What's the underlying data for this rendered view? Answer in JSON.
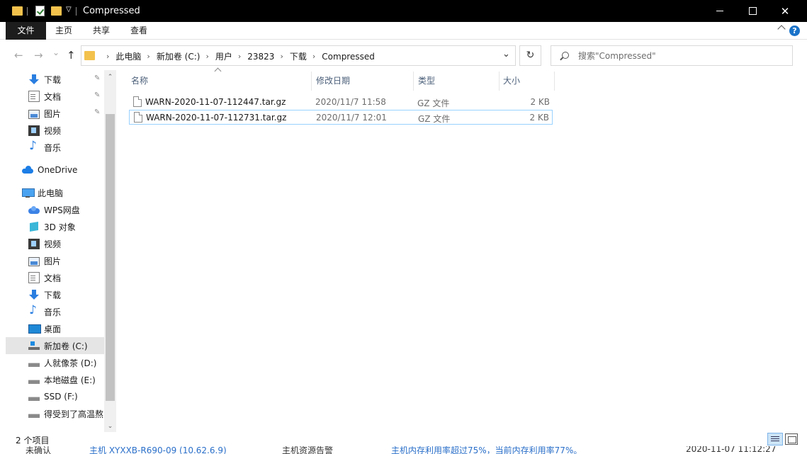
{
  "window": {
    "title": "Compressed",
    "minimize_glyph": "",
    "maximize_glyph": "",
    "close_glyph": "✕"
  },
  "ribbon": {
    "tabs": [
      "文件",
      "主页",
      "共享",
      "查看"
    ],
    "help_glyph": "?"
  },
  "nav": {
    "back_glyph": "←",
    "forward_glyph": "→",
    "recent_glyph": "⌄",
    "up_glyph": "↑",
    "breadcrumb": [
      "此电脑",
      "新加卷 (C:)",
      "用户",
      "23823",
      "下载",
      "Compressed"
    ],
    "crumb_sep": "›",
    "address_dropdown_glyph": "⌄",
    "refresh_glyph": "↻",
    "search_placeholder": "搜索\"Compressed\""
  },
  "sidebar": {
    "items": [
      {
        "label": "下载",
        "icon": "download-icon",
        "pinned": true
      },
      {
        "label": "文档",
        "icon": "document-icon",
        "pinned": true
      },
      {
        "label": "图片",
        "icon": "picture-icon",
        "pinned": true
      },
      {
        "label": "视频",
        "icon": "video-icon",
        "pinned": false
      },
      {
        "label": "音乐",
        "icon": "music-icon",
        "pinned": false
      },
      {
        "label": "OneDrive",
        "icon": "onedrive-icon",
        "pinned": false
      },
      {
        "label": "此电脑",
        "icon": "this-pc-icon",
        "pinned": false
      },
      {
        "label": "WPS网盘",
        "icon": "wps-cloud-icon",
        "pinned": false
      },
      {
        "label": "3D 对象",
        "icon": "3d-objects-icon",
        "pinned": false
      },
      {
        "label": "视频",
        "icon": "video-icon",
        "pinned": false
      },
      {
        "label": "图片",
        "icon": "picture-icon",
        "pinned": false
      },
      {
        "label": "文档",
        "icon": "document-icon",
        "pinned": false
      },
      {
        "label": "下载",
        "icon": "download-icon",
        "pinned": false
      },
      {
        "label": "音乐",
        "icon": "music-icon",
        "pinned": false
      },
      {
        "label": "桌面",
        "icon": "desktop-icon",
        "pinned": false
      },
      {
        "label": "新加卷 (C:)",
        "icon": "system-drive-icon",
        "pinned": false,
        "selected": true
      },
      {
        "label": "人就像茶 (D:)",
        "icon": "drive-icon",
        "pinned": false
      },
      {
        "label": "本地磁盘 (E:)",
        "icon": "drive-icon",
        "pinned": false
      },
      {
        "label": "SSD (F:)",
        "icon": "drive-icon",
        "pinned": false
      },
      {
        "label": "得受到了高温熬",
        "icon": "drive-icon",
        "pinned": false
      }
    ],
    "pin_glyph": "📌",
    "scroll_up_glyph": "⌃",
    "scroll_down_glyph": "⌄"
  },
  "filelist": {
    "columns": [
      "名称",
      "修改日期",
      "类型",
      "大小"
    ],
    "rows": [
      {
        "name": "WARN-2020-11-07-112447.tar.gz",
        "date": "2020/11/7 11:58",
        "type": "GZ 文件",
        "size": "2 KB",
        "selected": false
      },
      {
        "name": "WARN-2020-11-07-112731.tar.gz",
        "date": "2020/11/7 12:01",
        "type": "GZ 文件",
        "size": "2 KB",
        "selected": true
      }
    ]
  },
  "status": {
    "item_count": "2 个项目"
  },
  "background_window": {
    "texts": [
      "未确认",
      "主机 XYXXB-R690-09 (10.62.6.9)",
      "主机资源告警",
      "主机内存利用率超过75%，当前内存利用率77%。",
      "2020-11-07 11:12:27"
    ]
  },
  "colors": {
    "accent": "#1a73c9",
    "selection_border": "#99d1ff",
    "folder": "#f3c24d"
  }
}
